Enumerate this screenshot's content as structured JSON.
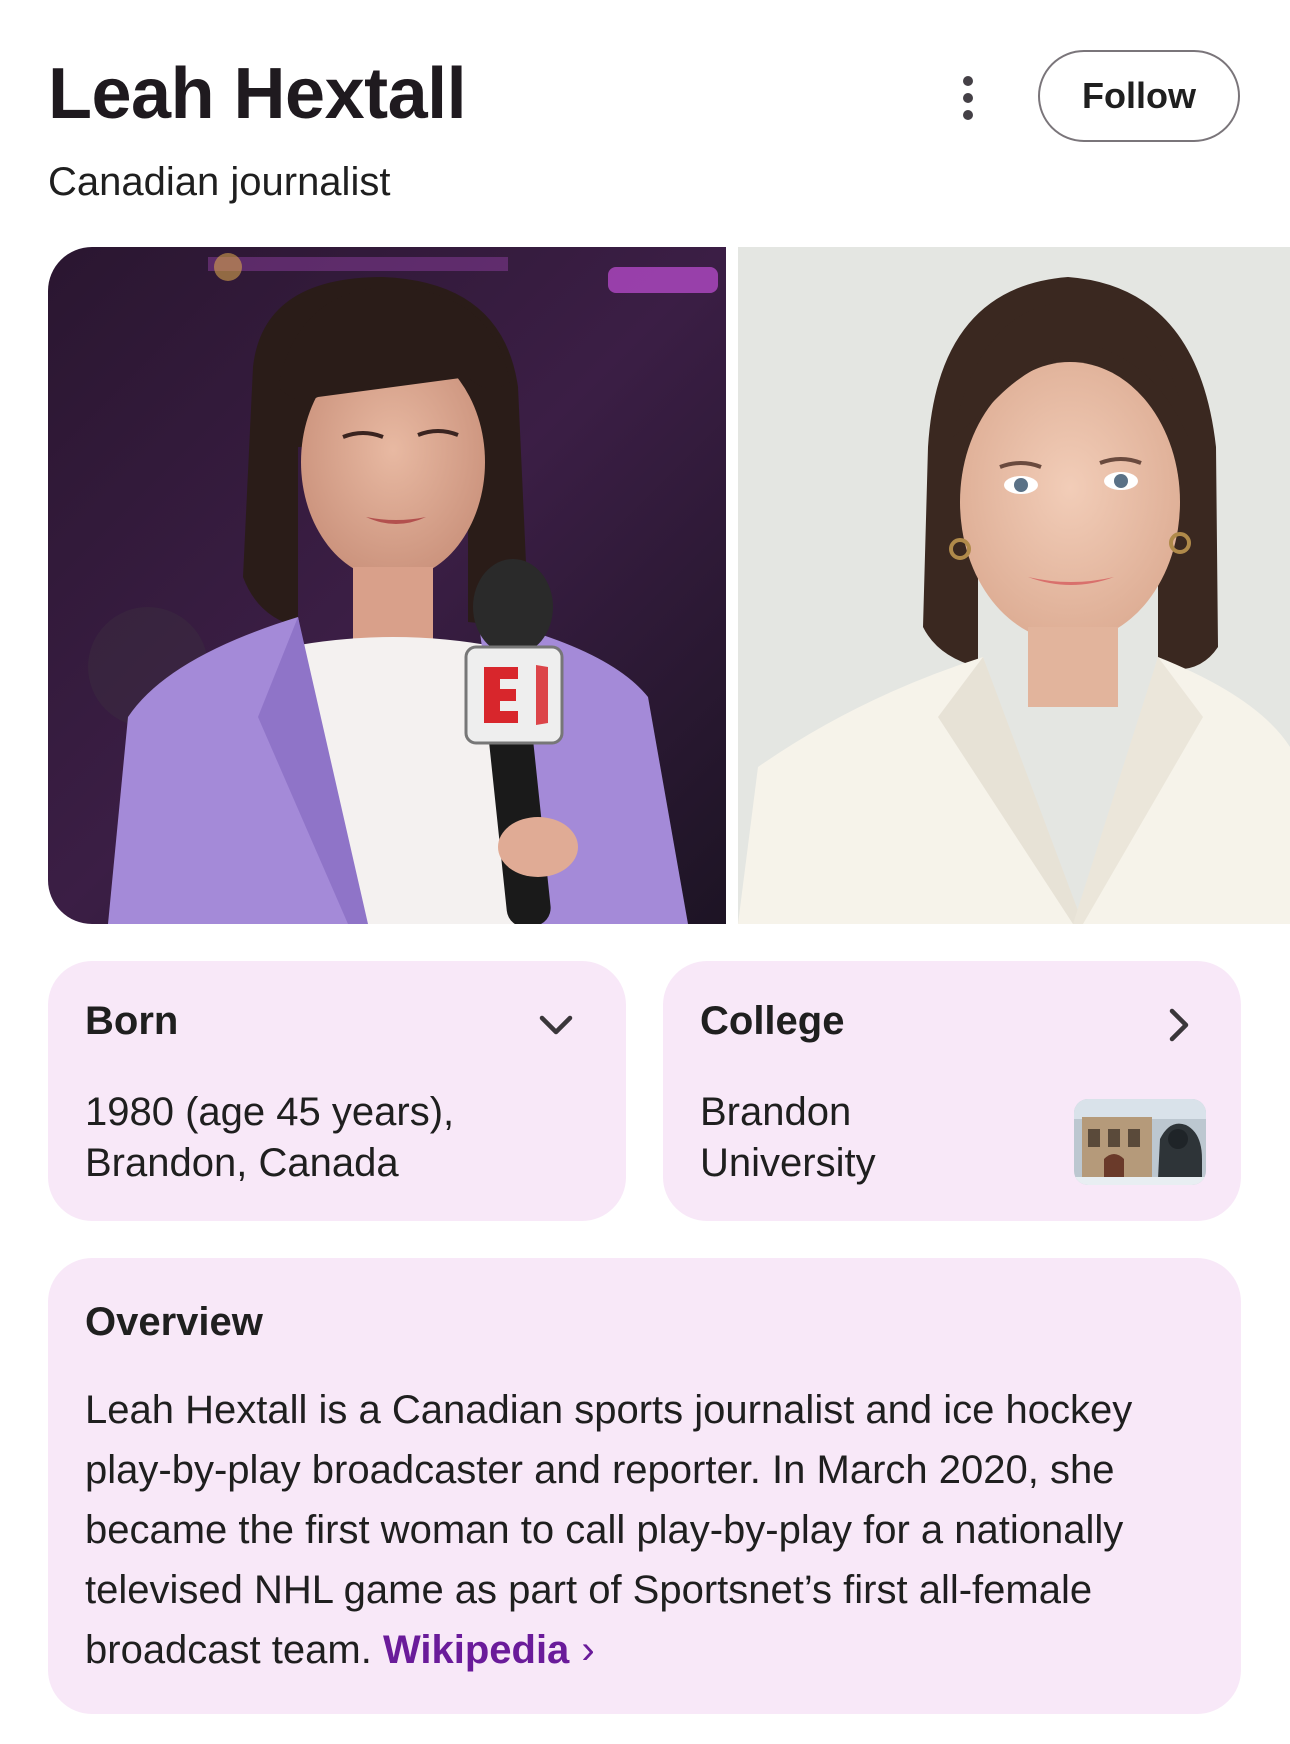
{
  "header": {
    "title": "Leah Hextall",
    "subtitle": "Canadian journalist",
    "follow_label": "Follow",
    "more_icon": "more-vert-icon"
  },
  "photos": [
    {
      "name": "photo-espn-microphone"
    },
    {
      "name": "photo-white-blazer"
    }
  ],
  "born": {
    "label": "Born",
    "value_line1": "1980 (age 45 years),",
    "value_line2": "Brandon, Canada",
    "icon": "chevron-down-icon"
  },
  "college": {
    "label": "College",
    "value_line1": "Brandon",
    "value_line2": "University",
    "icon": "chevron-right-icon"
  },
  "overview": {
    "label": "Overview",
    "text": "Leah Hextall is a Canadian sports journalist and ice hockey play-by-play broadcaster and reporter. In March 2020, she became the first woman to call play-by-play for a nationally televised NHL game as part of Sportsnet’s first all-female broadcast team.",
    "link_label": "Wikipedia",
    "link_chevron": "›"
  },
  "colors": {
    "card_bg": "#f8e8f8",
    "link": "#6a1b9a",
    "text": "#1f1f1f"
  }
}
